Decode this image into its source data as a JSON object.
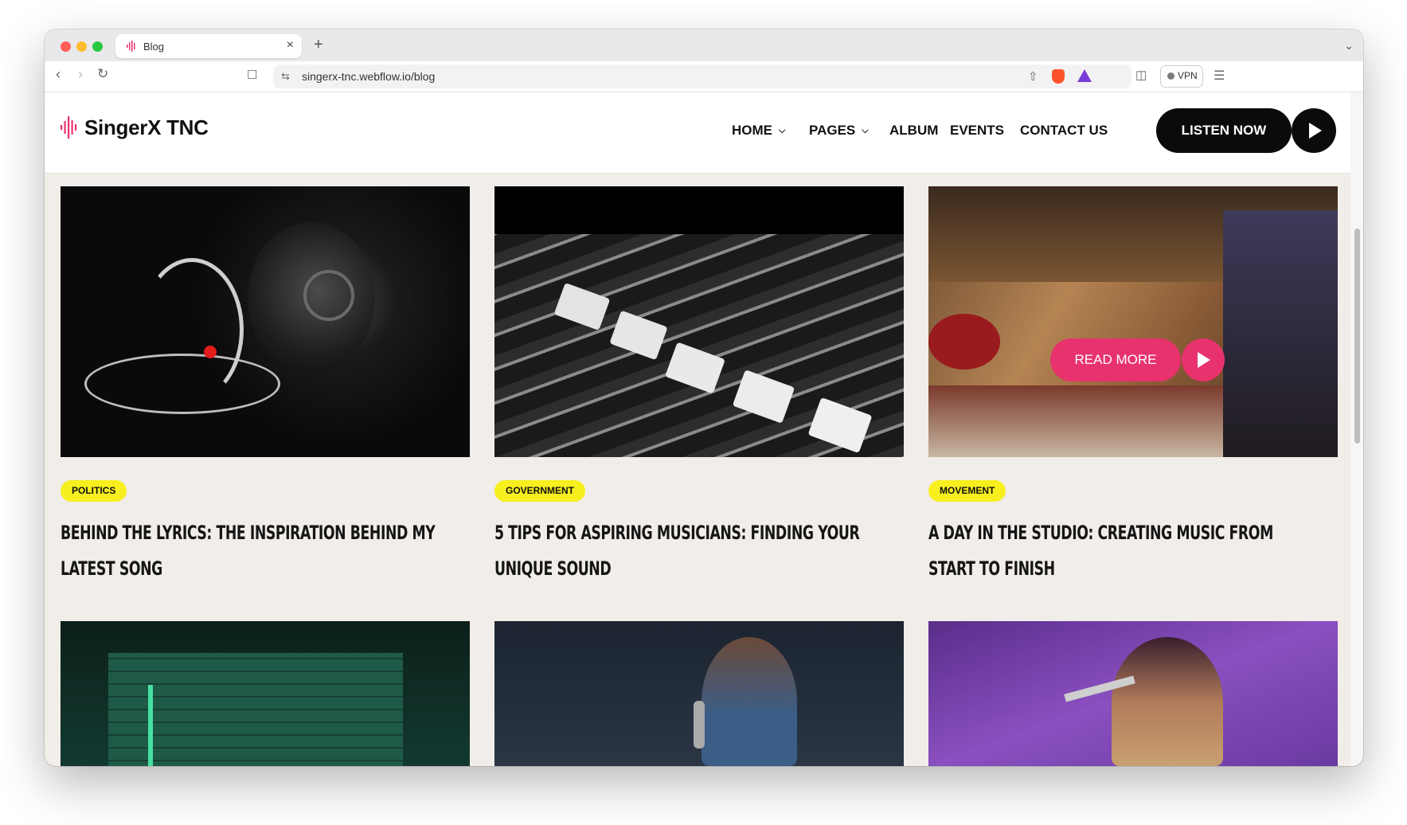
{
  "browser": {
    "tab_title": "Blog",
    "tab_close": "×",
    "new_tab": "+",
    "url": "singerx-tnc.webflow.io/blog",
    "vpn_label": "VPN"
  },
  "header": {
    "logo_text": "SingerX TNC",
    "menu": [
      {
        "label": "HOME",
        "has_dropdown": true
      },
      {
        "label": "PAGES",
        "has_dropdown": true
      },
      {
        "label": "ALBUM",
        "has_dropdown": false
      },
      {
        "label": "EVENTS",
        "has_dropdown": false
      },
      {
        "label": "CONTACT US",
        "has_dropdown": false
      }
    ],
    "listen_label": "LISTEN NOW"
  },
  "posts": [
    {
      "category": "POLITICS",
      "title": "BEHIND THE LYRICS: THE INSPIRATION BEHIND MY LATEST SONG",
      "image": "power-button-spring"
    },
    {
      "category": "GOVERNMENT",
      "title": "5 TIPS FOR ASPIRING MUSICIANS: FINDING YOUR UNIQUE SOUND",
      "image": "mixing-console-faders"
    },
    {
      "category": "MOVEMENT",
      "title": "A DAY IN THE STUDIO: CREATING MUSIC FROM START TO FINISH",
      "image": "band-in-studio",
      "hover_label": "READ MORE"
    },
    {
      "image": "green-studio-wall"
    },
    {
      "image": "woman-singing-microphone"
    },
    {
      "image": "singer-purple-light"
    }
  ],
  "colors": {
    "accent": "#e8326e",
    "badge": "#f7ef1e",
    "page_bg": "#f1ede8",
    "button_dark": "#0b0b0b"
  }
}
